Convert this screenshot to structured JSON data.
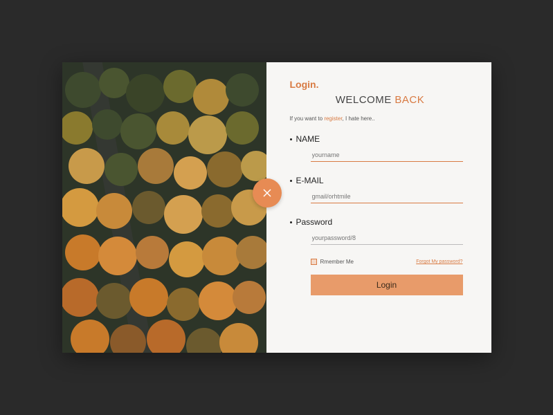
{
  "brand": "Login.",
  "welcome_a": "WELCOME ",
  "welcome_b": "BACK",
  "hint_pre": "If you want to ",
  "hint_link": "register",
  "hint_post": ", I hate here..",
  "fields": {
    "name": {
      "label": "NAME",
      "placeholder": "yourname"
    },
    "email": {
      "label": "E-MAIL",
      "placeholder": "gmail/orhtmile"
    },
    "password": {
      "label": "Password",
      "placeholder": "yourpassword/8"
    }
  },
  "remember": "Rmember Me",
  "forgot": "Forgot My password?",
  "login_btn": "Login",
  "colors": {
    "accent": "#d87a42"
  }
}
